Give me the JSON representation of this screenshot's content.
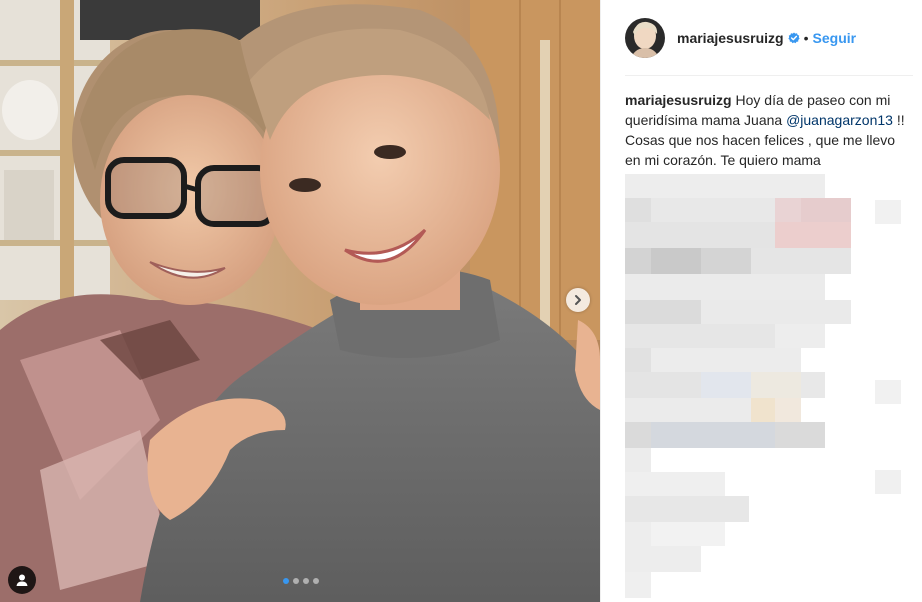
{
  "post": {
    "image_alt": "Selfie de madre e hija",
    "carousel": {
      "total": 4,
      "active": 0
    }
  },
  "author": {
    "username": "mariajesusruizg",
    "verified": true,
    "separator": "•",
    "follow_label": "Seguir"
  },
  "caption": {
    "username": "mariajesusruizg",
    "text_before": " Hoy día de paseo con mi queridísima mama Juana ",
    "mention": "@juanagarzon13",
    "text_after": " !! Cosas que nos hacen felices , que me llevo en mi corazón. Te quiero mama"
  },
  "icons": {
    "next": "chevron-right-icon",
    "tag": "user-tag-icon",
    "verified": "verified-badge-icon"
  },
  "colors": {
    "accent": "#3897f0",
    "mention": "#003569",
    "text": "#262626",
    "divider": "#efefef"
  }
}
